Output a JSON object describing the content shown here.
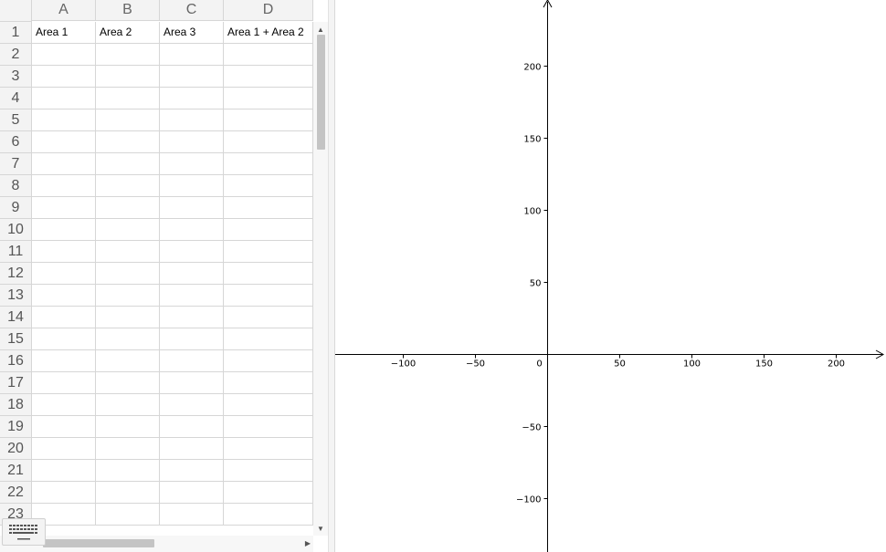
{
  "spreadsheet": {
    "columns": [
      "A",
      "B",
      "C",
      "D"
    ],
    "rows": [
      "1",
      "2",
      "3",
      "4",
      "5",
      "6",
      "7",
      "8",
      "9",
      "10",
      "11",
      "12",
      "13",
      "14",
      "15",
      "16",
      "17",
      "18",
      "19",
      "20",
      "21",
      "22",
      "23"
    ],
    "row1_cells": [
      "Area 1",
      "Area 2",
      "Area 3",
      "Area 1 + Area 2"
    ],
    "scroll_arrows": {
      "up": "▲",
      "down": "▼",
      "right": "▶"
    }
  },
  "keyboard": {
    "icon": "keyboard-icon"
  },
  "graph": {
    "x_ticks": [
      "−100",
      "−50",
      "0",
      "50",
      "100",
      "150",
      "200"
    ],
    "y_ticks": [
      "200",
      "150",
      "100",
      "50",
      "−50",
      "−100"
    ]
  },
  "colors": {
    "grid_line": "#d6d6d6",
    "header_bg": "#f3f3f3",
    "axis": "#000000"
  }
}
